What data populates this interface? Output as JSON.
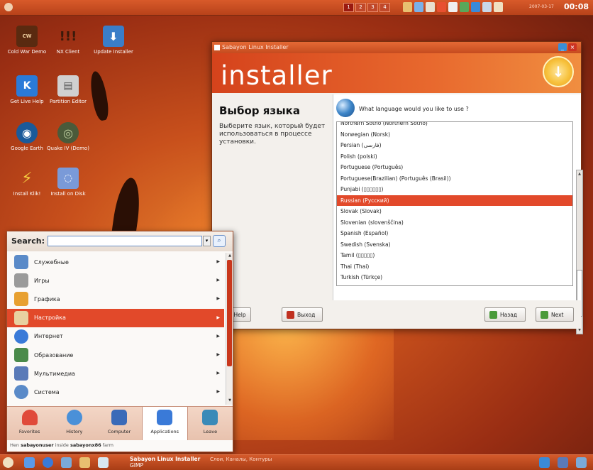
{
  "top_panel": {
    "workspaces": [
      "1",
      "2",
      "3",
      "4"
    ],
    "date": "2007-03-17",
    "time": "00:08"
  },
  "desktop_icons": [
    {
      "label": "Cold War Demo",
      "icon": "coldwar-icon",
      "color": "#6b3a1a",
      "glyph": "COLD WAR"
    },
    {
      "label": "NX Client",
      "icon": "nx-client-icon",
      "color": "#c8421c",
      "glyph": "!!!"
    },
    {
      "label": "Update Installer",
      "icon": "update-installer-icon",
      "color": "#3a7ec8",
      "glyph": "⬇"
    },
    {
      "label": "Get Live Help",
      "icon": "live-help-icon",
      "color": "#2a7ad8",
      "glyph": "K"
    },
    {
      "label": "Partition Editor",
      "icon": "partition-editor-icon",
      "color": "#c8c8c8",
      "glyph": "▤"
    },
    {
      "label": "Google Earth",
      "icon": "google-earth-icon",
      "color": "#1a5a9a",
      "glyph": "◉"
    },
    {
      "label": "Quake IV (Demo)",
      "icon": "quake-icon",
      "color": "#4a5a3a",
      "glyph": "◎"
    },
    {
      "label": "Install Klik!",
      "icon": "klik-icon",
      "color": "#c8421c",
      "glyph": "⚡"
    },
    {
      "label": "Install on Disk",
      "icon": "install-disk-icon",
      "color": "#6a8ac8",
      "glyph": "◌"
    }
  ],
  "installer": {
    "window_title": "Sabayon Linux Installer",
    "banner": "installer",
    "step_title": "Выбор языка",
    "step_desc": "Выберите язык, который будет использоваться в процессе установки.",
    "question": "What language would you like to use ?",
    "languages": [
      "Northern Sotho (Northern Sotho)",
      "Norwegian (Norsk)",
      "Persian (فارسی)",
      "Polish (polski)",
      "Portuguese (Português)",
      "Portuguese(Brazilian) (Português (Brasil))",
      "Punjabi (▯▯▯▯▯▯)",
      "Russian (Русский)",
      "Slovak (Slovak)",
      "Slovenian (slovenščina)",
      "Spanish (Español)",
      "Swedish (Svenska)",
      "Tamil (▯▯▯▯▯)",
      "Thai (Thai)",
      "Turkish (Türkçe)"
    ],
    "selected_language": "Russian (Русский)",
    "buttons": {
      "hide_help": "Hide Help",
      "exit": "Выход",
      "back": "Назад",
      "next": "Next"
    }
  },
  "menu": {
    "search_label": "Search:",
    "search_value": "",
    "items": [
      {
        "label": "Служебные",
        "icon": "utilities-icon",
        "color": "#5a8ac8"
      },
      {
        "label": "Игры",
        "icon": "games-icon",
        "color": "#8a8a8a"
      },
      {
        "label": "Графика",
        "icon": "graphics-icon",
        "color": "#e8a030"
      },
      {
        "label": "Настройка",
        "icon": "settings-icon",
        "color": "#e8d0a0"
      },
      {
        "label": "Интернет",
        "icon": "internet-icon",
        "color": "#3a7ad8"
      },
      {
        "label": "Образование",
        "icon": "education-icon",
        "color": "#4a8a4a"
      },
      {
        "label": "Мультимедиа",
        "icon": "multimedia-icon",
        "color": "#5a7ab8"
      },
      {
        "label": "Система",
        "icon": "system-icon",
        "color": "#5a8ac8"
      }
    ],
    "selected_item": "Настройка",
    "tabs": [
      {
        "label": "Favorites",
        "icon": "heart-icon",
        "color": "#e04a3a"
      },
      {
        "label": "History",
        "icon": "clock-icon",
        "color": "#4a90d8"
      },
      {
        "label": "Computer",
        "icon": "computer-icon",
        "color": "#3a6ab8"
      },
      {
        "label": "Applications",
        "icon": "applications-icon",
        "color": "#3a7ad8"
      },
      {
        "label": "Leave",
        "icon": "leave-icon",
        "color": "#3a8ab8"
      }
    ],
    "active_tab": "Applications",
    "footer_prefix": "Hen ",
    "footer_user": "sabayonuser",
    "footer_mid": " inside ",
    "footer_host": "sabayonx86",
    "footer_suffix": " farm"
  },
  "taskbar": {
    "task1_line1": "Sabayon Linux Installer",
    "task1_line2": "GIMP",
    "task2": "Слои, Каналы, Контуры"
  },
  "colors": {
    "accent": "#e2492a",
    "panel": "#c54b1f"
  }
}
